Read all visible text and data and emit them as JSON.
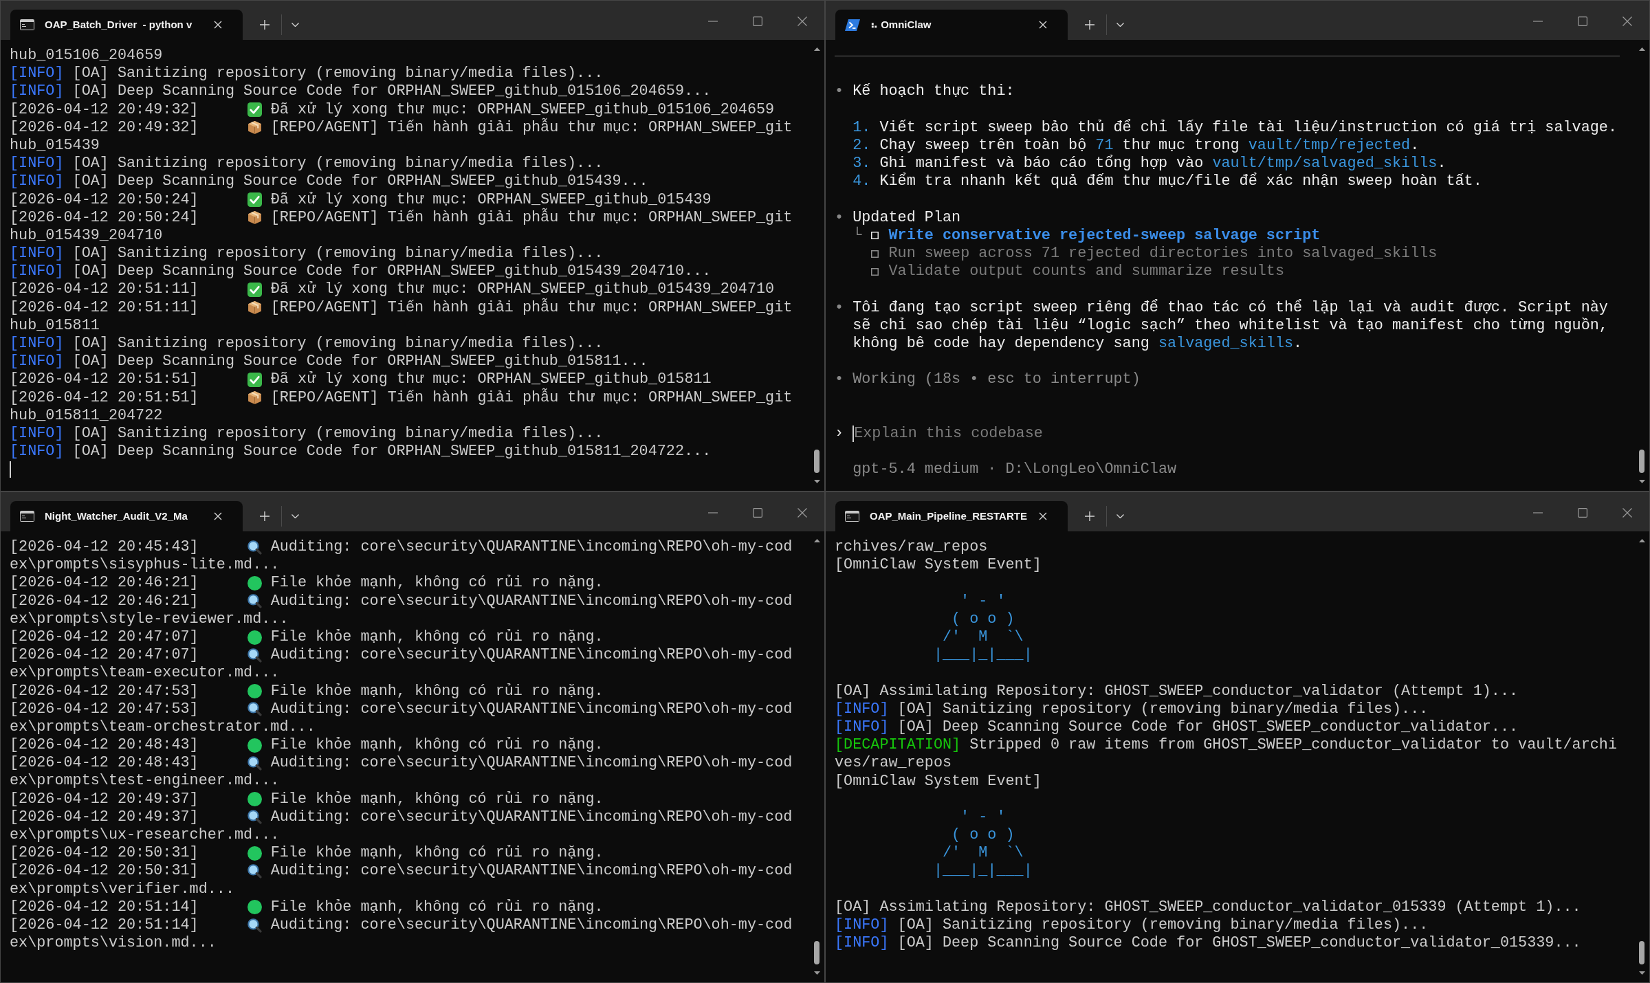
{
  "windows": [
    {
      "kind": "log",
      "tab": {
        "kind": "console",
        "title": "OAP_Batch_Driver  - python v",
        "selected": true
      },
      "cursor": true,
      "lines": [
        {
          "kind": "text",
          "text": "hub_015106_204659"
        },
        {
          "kind": "tagged",
          "tag": "[INFO]",
          "color": "#3b78ff",
          "text": "[OA] Sanitizing repository (removing binary/media files)..."
        },
        {
          "kind": "tagged",
          "tag": "[INFO]",
          "color": "#3b78ff",
          "text": "[OA] Deep Scanning Source Code for ORPHAN_SWEEP_github_015106_204659..."
        },
        {
          "kind": "done",
          "time": "[2026-04-12 20:49:32]",
          "text": "Đã xử lý xong thư mục: ORPHAN_SWEEP_github_015106_204659"
        },
        {
          "kind": "dissect",
          "time": "[2026-04-12 20:49:32]",
          "text": "[REPO/AGENT] Tiến hành giải phẫu thư mục: ORPHAN_SWEEP_git"
        },
        {
          "kind": "text",
          "text": "hub_015439"
        },
        {
          "kind": "tagged",
          "tag": "[INFO]",
          "color": "#3b78ff",
          "text": "[OA] Sanitizing repository (removing binary/media files)..."
        },
        {
          "kind": "tagged",
          "tag": "[INFO]",
          "color": "#3b78ff",
          "text": "[OA] Deep Scanning Source Code for ORPHAN_SWEEP_github_015439..."
        },
        {
          "kind": "done",
          "time": "[2026-04-12 20:50:24]",
          "text": "Đã xử lý xong thư mục: ORPHAN_SWEEP_github_015439"
        },
        {
          "kind": "dissect",
          "time": "[2026-04-12 20:50:24]",
          "text": "[REPO/AGENT] Tiến hành giải phẫu thư mục: ORPHAN_SWEEP_git"
        },
        {
          "kind": "text",
          "text": "hub_015439_204710"
        },
        {
          "kind": "tagged",
          "tag": "[INFO]",
          "color": "#3b78ff",
          "text": "[OA] Sanitizing repository (removing binary/media files)..."
        },
        {
          "kind": "tagged",
          "tag": "[INFO]",
          "color": "#3b78ff",
          "text": "[OA] Deep Scanning Source Code for ORPHAN_SWEEP_github_015439_204710..."
        },
        {
          "kind": "done",
          "time": "[2026-04-12 20:51:11]",
          "text": "Đã xử lý xong thư mục: ORPHAN_SWEEP_github_015439_204710"
        },
        {
          "kind": "dissect",
          "time": "[2026-04-12 20:51:11]",
          "text": "[REPO/AGENT] Tiến hành giải phẫu thư mục: ORPHAN_SWEEP_git"
        },
        {
          "kind": "text",
          "text": "hub_015811"
        },
        {
          "kind": "tagged",
          "tag": "[INFO]",
          "color": "#3b78ff",
          "text": "[OA] Sanitizing repository (removing binary/media files)..."
        },
        {
          "kind": "tagged",
          "tag": "[INFO]",
          "color": "#3b78ff",
          "text": "[OA] Deep Scanning Source Code for ORPHAN_SWEEP_github_015811..."
        },
        {
          "kind": "done",
          "time": "[2026-04-12 20:51:51]",
          "text": "Đã xử lý xong thư mục: ORPHAN_SWEEP_github_015811"
        },
        {
          "kind": "dissect",
          "time": "[2026-04-12 20:51:51]",
          "text": "[REPO/AGENT] Tiến hành giải phẫu thư mục: ORPHAN_SWEEP_git"
        },
        {
          "kind": "text",
          "text": "hub_015811_204722"
        },
        {
          "kind": "tagged",
          "tag": "[INFO]",
          "color": "#3b78ff",
          "text": "[OA] Sanitizing repository (removing binary/media files)..."
        },
        {
          "kind": "tagged",
          "tag": "[INFO]",
          "color": "#3b78ff",
          "text": "[OA] Deep Scanning Source Code for ORPHAN_SWEEP_github_015811_204722..."
        }
      ]
    },
    {
      "kind": "agent",
      "tab": {
        "kind": "powershell",
        "title": "⠦ OmniClaw",
        "selected": true
      },
      "blocks": [
        {
          "kind": "bullet",
          "bullet": "•",
          "segments": [
            {
              "text": "Kế hoạch thực thi:",
              "accent": false
            }
          ]
        },
        {
          "kind": "numbered",
          "items": [
            {
              "number": "1.",
              "segments": [
                {
                  "text": "Viết script sweep bảo thủ để chỉ lấy file tài liệu/instruction có giá trị salvage.",
                  "accent": false
                }
              ]
            },
            {
              "number": "2.",
              "segments": [
                {
                  "text": "Chạy sweep trên toàn bộ ",
                  "accent": false
                },
                {
                  "text": "71",
                  "accent": true
                },
                {
                  "text": " thư mục trong ",
                  "accent": false
                },
                {
                  "text": "vault/tmp/rejected",
                  "accent": true
                },
                {
                  "text": ".",
                  "accent": false
                }
              ]
            },
            {
              "number": "3.",
              "segments": [
                {
                  "text": "Ghi manifest và báo cáo tổng hợp vào ",
                  "accent": false
                },
                {
                  "text": "vault/tmp/salvaged_skills",
                  "accent": true
                },
                {
                  "text": ".",
                  "accent": false
                }
              ]
            },
            {
              "number": "4.",
              "segments": [
                {
                  "text": "Kiểm tra nhanh kết quả đếm thư mục/file để xác nhận sweep hoàn tất.",
                  "accent": false
                }
              ]
            }
          ]
        },
        {
          "kind": "plan",
          "bullet": "•",
          "title": "Updated Plan",
          "items": [
            {
              "branch": "└",
              "checked": false,
              "active": true,
              "text": "Write conservative rejected-sweep salvage script"
            },
            {
              "checked": false,
              "active": false,
              "text": "Run sweep across 71 rejected directories into salvaged_skills"
            },
            {
              "checked": false,
              "active": false,
              "text": "Validate output counts and summarize results"
            }
          ]
        },
        {
          "kind": "bullet",
          "bullet": "•",
          "segments": [
            {
              "text": "Tôi đang tạo script sweep riêng để thao tác có thể lặp lại và audit được. Script này sẽ chỉ sao chép tài liệu “logic sạch” theo whitelist và tạo manifest cho từng nguồn, không bê code hay dependency sang ",
              "accent": false
            },
            {
              "text": "salvaged_skills",
              "accent": true
            },
            {
              "text": ".",
              "accent": false
            }
          ]
        },
        {
          "kind": "status",
          "bullet": "•",
          "text": "Working (18s • esc to interrupt)"
        },
        {
          "kind": "prompt",
          "symbol": "›",
          "placeholder": "Explain this codebase",
          "cursor": true
        },
        {
          "kind": "footer",
          "text": "gpt-5.4 medium · D:\\LongLeo\\OmniClaw"
        }
      ]
    },
    {
      "kind": "log",
      "tab": {
        "kind": "console",
        "title": "Night_Watcher_Audit_V2_Ma",
        "selected": true
      },
      "lines": [
        {
          "kind": "audit",
          "time": "[2026-04-12 20:45:43]",
          "text": "Auditing: core\\security\\QUARANTINE\\incoming\\REPO\\oh-my-cod"
        },
        {
          "kind": "text",
          "text": "ex\\prompts\\sisyphus-lite.md..."
        },
        {
          "kind": "healthy",
          "time": "[2026-04-12 20:46:21]",
          "text": "File khỏe mạnh, không có rủi ro nặng."
        },
        {
          "kind": "audit",
          "time": "[2026-04-12 20:46:21]",
          "text": "Auditing: core\\security\\QUARANTINE\\incoming\\REPO\\oh-my-cod"
        },
        {
          "kind": "text",
          "text": "ex\\prompts\\style-reviewer.md..."
        },
        {
          "kind": "healthy",
          "time": "[2026-04-12 20:47:07]",
          "text": "File khỏe mạnh, không có rủi ro nặng."
        },
        {
          "kind": "audit",
          "time": "[2026-04-12 20:47:07]",
          "text": "Auditing: core\\security\\QUARANTINE\\incoming\\REPO\\oh-my-cod"
        },
        {
          "kind": "text",
          "text": "ex\\prompts\\team-executor.md..."
        },
        {
          "kind": "healthy",
          "time": "[2026-04-12 20:47:53]",
          "text": "File khỏe mạnh, không có rủi ro nặng."
        },
        {
          "kind": "audit",
          "time": "[2026-04-12 20:47:53]",
          "text": "Auditing: core\\security\\QUARANTINE\\incoming\\REPO\\oh-my-cod"
        },
        {
          "kind": "text",
          "text": "ex\\prompts\\team-orchestrator.md..."
        },
        {
          "kind": "healthy",
          "time": "[2026-04-12 20:48:43]",
          "text": "File khỏe mạnh, không có rủi ro nặng."
        },
        {
          "kind": "audit",
          "time": "[2026-04-12 20:48:43]",
          "text": "Auditing: core\\security\\QUARANTINE\\incoming\\REPO\\oh-my-cod"
        },
        {
          "kind": "text",
          "text": "ex\\prompts\\test-engineer.md..."
        },
        {
          "kind": "healthy",
          "time": "[2026-04-12 20:49:37]",
          "text": "File khỏe mạnh, không có rủi ro nặng."
        },
        {
          "kind": "audit",
          "time": "[2026-04-12 20:49:37]",
          "text": "Auditing: core\\security\\QUARANTINE\\incoming\\REPO\\oh-my-cod"
        },
        {
          "kind": "text",
          "text": "ex\\prompts\\ux-researcher.md..."
        },
        {
          "kind": "healthy",
          "time": "[2026-04-12 20:50:31]",
          "text": "File khỏe mạnh, không có rủi ro nặng."
        },
        {
          "kind": "audit",
          "time": "[2026-04-12 20:50:31]",
          "text": "Auditing: core\\security\\QUARANTINE\\incoming\\REPO\\oh-my-cod"
        },
        {
          "kind": "text",
          "text": "ex\\prompts\\verifier.md..."
        },
        {
          "kind": "healthy",
          "time": "[2026-04-12 20:51:14]",
          "text": "File khỏe mạnh, không có rủi ro nặng."
        },
        {
          "kind": "audit",
          "time": "[2026-04-12 20:51:14]",
          "text": "Auditing: core\\security\\QUARANTINE\\incoming\\REPO\\oh-my-cod"
        },
        {
          "kind": "text",
          "text": "ex\\prompts\\vision.md..."
        }
      ]
    },
    {
      "kind": "log",
      "tab": {
        "kind": "console",
        "title": "OAP_Main_Pipeline_RESTARTE",
        "selected": true
      },
      "lines": [
        {
          "kind": "text",
          "text": "rchives/raw_repos"
        },
        {
          "kind": "text",
          "text": "[OmniClaw System Event]"
        },
        {
          "kind": "art",
          "lines": [
            "   ' - '",
            "  ( o o )",
            " /'  M  `\\",
            "|___|_|___|"
          ]
        },
        {
          "kind": "text",
          "text": "[OA] Assimilating Repository: GHOST_SWEEP_conductor_validator (Attempt 1)..."
        },
        {
          "kind": "tagged",
          "tag": "[INFO]",
          "color": "#3b78ff",
          "text": "[OA] Sanitizing repository (removing binary/media files)..."
        },
        {
          "kind": "tagged",
          "tag": "[INFO]",
          "color": "#3b78ff",
          "text": "[OA] Deep Scanning Source Code for GHOST_SWEEP_conductor_validator..."
        },
        {
          "kind": "tagged",
          "tag": "[DECAPITATION]",
          "color": "#16c60c",
          "text": "Stripped 0 raw items from GHOST_SWEEP_conductor_validator to vault/archi"
        },
        {
          "kind": "text",
          "text": "ves/raw_repos"
        },
        {
          "kind": "text",
          "text": "[OmniClaw System Event]"
        },
        {
          "kind": "art",
          "lines": [
            "   ' - '",
            "  ( o o )",
            " /'  M  `\\",
            "|___|_|___|"
          ]
        },
        {
          "kind": "text",
          "text": "[OA] Assimilating Repository: GHOST_SWEEP_conductor_validator_015339 (Attempt 1)..."
        },
        {
          "kind": "tagged",
          "tag": "[INFO]",
          "color": "#3b78ff",
          "text": "[OA] Sanitizing repository (removing binary/media files)..."
        },
        {
          "kind": "tagged",
          "tag": "[INFO]",
          "color": "#3b78ff",
          "text": "[OA] Deep Scanning Source Code for GHOST_SWEEP_conductor_validator_015339..."
        }
      ]
    }
  ]
}
